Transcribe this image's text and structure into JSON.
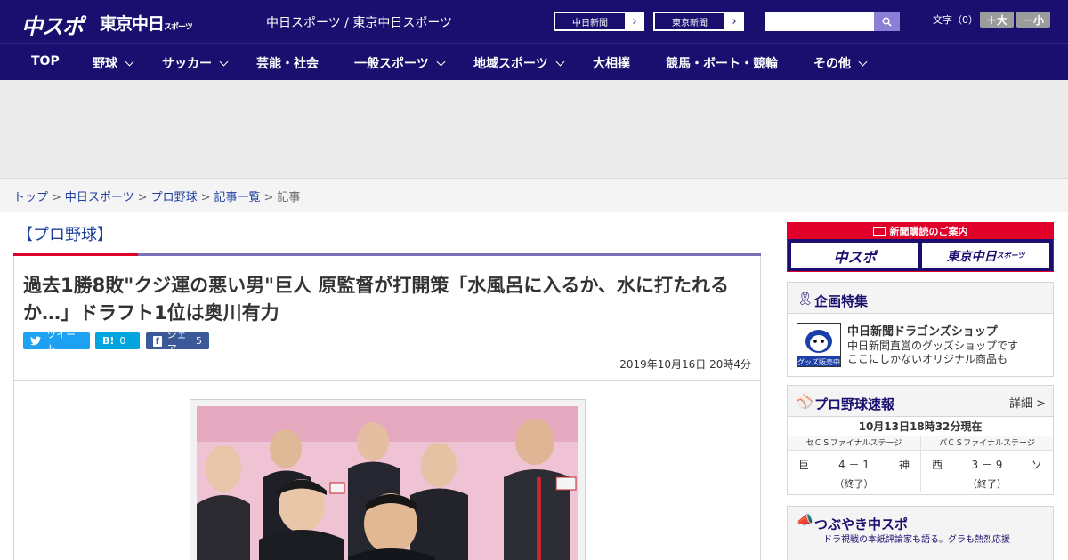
{
  "header": {
    "logo_main": "中スポ",
    "logo_tokyo": "東京中日",
    "logo_tokyo_small": "スポーツ",
    "site_title": "中日スポーツ / 東京中日スポーツ",
    "links": [
      {
        "label": "中日新聞"
      },
      {
        "label": "東京新聞"
      }
    ],
    "search": {
      "placeholder": ""
    },
    "font_size_label": "文字（0）",
    "font_larger": "＋大",
    "font_smaller": "－小"
  },
  "nav": {
    "items": [
      {
        "label": "TOP",
        "dropdown": false
      },
      {
        "label": "野球",
        "dropdown": true
      },
      {
        "label": "サッカー",
        "dropdown": true
      },
      {
        "label": "芸能・社会",
        "dropdown": false
      },
      {
        "label": "一般スポーツ",
        "dropdown": true
      },
      {
        "label": "地域スポーツ",
        "dropdown": true
      },
      {
        "label": "大相撲",
        "dropdown": false
      },
      {
        "label": "競馬・ボート・競輪",
        "dropdown": false
      },
      {
        "label": "その他",
        "dropdown": true
      }
    ]
  },
  "breadcrumb": {
    "items": [
      "トップ",
      "中日スポーツ",
      "プロ野球",
      "記事一覧"
    ],
    "current": "記事",
    "separator": ">"
  },
  "article": {
    "category": "【プロ野球】",
    "headline": "過去1勝8敗\"クジ運の悪い男\"巨人 原監督が打開策「水風呂に入るか、水に打たれるか…」ドラフト1位は奥川有力",
    "share": {
      "tweet": "ツイート",
      "hatena_icon": "B!",
      "hatena_count": "0",
      "facebook_label": "シェア",
      "facebook_count": "5"
    },
    "date": "2019年10月16日 20時4分"
  },
  "sidebar": {
    "promo": {
      "title": "新聞購読のご案内",
      "buttons": [
        "中スポ",
        "東京中日"
      ],
      "tokyo_small": "スポーツ"
    },
    "feature": {
      "title": "企画特集",
      "shop_name": "中日新聞ドラゴンズショップ",
      "shop_desc_1": "中日新聞直営のグッズショップです",
      "shop_desc_2": "ここにしかないオリジナル商品も",
      "thumb_label": "グッズ販売中"
    },
    "scores": {
      "title": "プロ野球速報",
      "more": "詳細 >",
      "as_of": "10月13日18時32分現在",
      "games": [
        {
          "stage": "セＣＳファイナルステージ",
          "home": "巨",
          "score": "4 － 1",
          "away": "神",
          "status": "（終了）"
        },
        {
          "stage": "パＣＳファイナルステージ",
          "home": "西",
          "score": "3 － 9",
          "away": "ソ",
          "status": "（終了）"
        }
      ]
    },
    "tsubuyaki": {
      "title": "つぶやき中スポ",
      "subtitle": "ドラ視戦の本紙評論家も語る。グラも熱烈応援"
    }
  },
  "colors": {
    "brand_navy": "#1a0f6e",
    "accent_red": "#e0002a",
    "link_blue": "#1f3f9e",
    "twitter": "#1da1f2",
    "hatena": "#00a4de",
    "facebook": "#3b5998"
  }
}
